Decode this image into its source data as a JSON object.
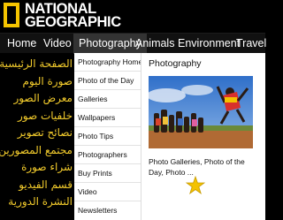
{
  "logo": {
    "line1": "NATIONAL",
    "line2": "GEOGRAPHIC"
  },
  "nav": {
    "items": [
      {
        "label": "Home"
      },
      {
        "label": "Video"
      },
      {
        "label": "Photography",
        "active": true
      },
      {
        "label": "Animals"
      },
      {
        "label": "Environment"
      },
      {
        "label": "Travel"
      }
    ]
  },
  "arabic_links": [
    "الصفحة الرئيسية",
    "صورة اليوم",
    "معرض الصور",
    "خلفيات صور",
    "نصائح تصوير",
    "مجتمع المصورين",
    "شراء صورة",
    "قسم الفيديو",
    "النشرة الدورية"
  ],
  "dropdown": {
    "menu": [
      "Photography Home",
      "Photo of the Day",
      "Galleries",
      "Wallpapers",
      "Photo Tips",
      "Photographers",
      "Buy Prints",
      "Video",
      "Newsletters"
    ],
    "feature_title": "Photography",
    "feature_caption": "Photo Galleries, Photo of the Day, Photo ..."
  },
  "colors": {
    "accent": "#f5c400",
    "arabic_text": "#f2cb2c",
    "star": "#f3c200"
  },
  "icons": {
    "highlight": "star-icon"
  }
}
